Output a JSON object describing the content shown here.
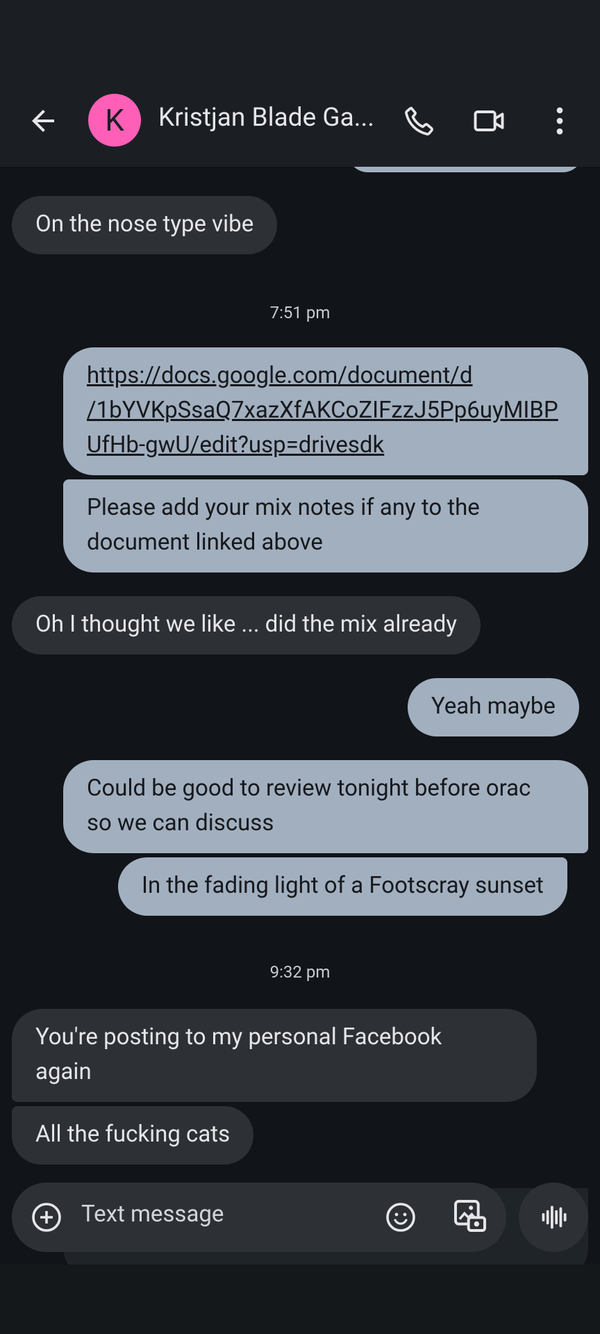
{
  "header": {
    "contact_initial": "K",
    "contact_name": "Kristjan Blade Ga..."
  },
  "messages": [
    {
      "type": "in",
      "text": "On the nose type vibe"
    },
    {
      "type": "time",
      "text": "7:51 pm"
    },
    {
      "type": "out",
      "link": true,
      "lines": [
        "https://docs.google.com/document/d",
        "/1bYVKpSsaQ7xazXfAKCoZIFzzJ5Pp6uyMIBP",
        "UfHb-gwU/edit?usp=drivesdk"
      ]
    },
    {
      "type": "out",
      "lines": [
        "Please add your mix notes if any to the",
        "document linked above"
      ]
    },
    {
      "type": "in",
      "text": "Oh I thought we like ... did the mix already"
    },
    {
      "type": "out",
      "text": "Yeah maybe"
    },
    {
      "type": "out",
      "lines": [
        "Could be good to review tonight before orac",
        "so we can discuss"
      ]
    },
    {
      "type": "out",
      "text": "In the fading light of a Footscray sunset"
    },
    {
      "type": "time",
      "text": "9:32 pm"
    },
    {
      "type": "in",
      "lines": [
        "You're posting to my personal Facebook",
        "again"
      ]
    },
    {
      "type": "in",
      "text": "All the fucking cats"
    }
  ],
  "composer": {
    "placeholder": "Text message"
  },
  "icons": [
    "back-arrow-icon",
    "phone-icon",
    "video-icon",
    "more-vert-icon",
    "plus-circle-icon",
    "emoji-icon",
    "gallery-icon",
    "voice-wave-icon"
  ],
  "colors": {
    "background": "#111418",
    "incoming_bubble": "#2d3136",
    "outgoing_bubble": "#a2afbf",
    "avatar": "#ff5fb7"
  }
}
